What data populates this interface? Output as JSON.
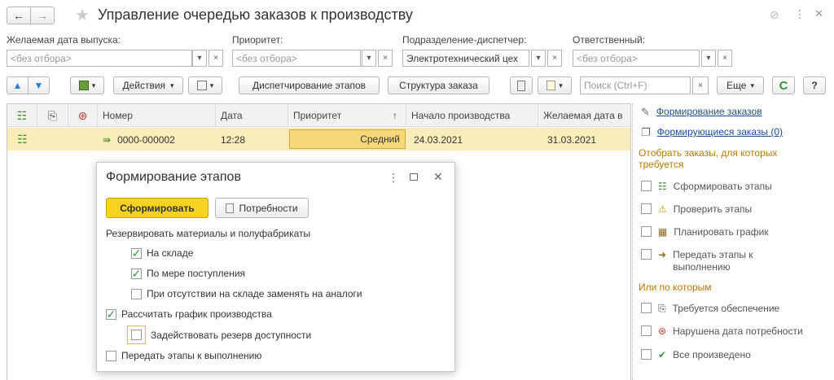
{
  "header": {
    "title": "Управление очередью заказов к производству",
    "back": "←",
    "forward": "→"
  },
  "filters": {
    "date_label": "Желаемая дата выпуска:",
    "date_value": "<без отбора>",
    "priority_label": "Приоритет:",
    "priority_value": "<без отбора>",
    "division_label": "Подразделение-диспетчер:",
    "division_value": "Электротехнический цех",
    "responsible_label": "Ответственный:",
    "responsible_value": "<без отбора>"
  },
  "toolbar": {
    "actions": "Действия",
    "dispatch": "Диспетчирование этапов",
    "structure": "Структура заказа",
    "search_placeholder": "Поиск (Ctrl+F)",
    "more": "Еще",
    "help": "?"
  },
  "table": {
    "columns": [
      "Номер",
      "Дата",
      "Приоритет",
      "Начало производства",
      "Желаемая дата в"
    ],
    "sort_indicator": "↑",
    "rows": [
      {
        "number": "0000-000002",
        "date": "12:28",
        "priority": "Средний",
        "start": "24.03.2021",
        "desired": "31.03.2021"
      }
    ]
  },
  "dialog": {
    "title": "Формирование этапов",
    "primary": "Сформировать",
    "needs": "Потребности",
    "reserve_label": "Резервировать материалы и полуфабрикаты",
    "options": [
      {
        "label": "На складе",
        "checked": true
      },
      {
        "label": "По мере поступления",
        "checked": true
      },
      {
        "label": "При отсутствии на складе заменять на аналоги",
        "checked": false
      },
      {
        "label": "Рассчитать график производства",
        "checked": true
      },
      {
        "label": "Задействовать резерв доступности",
        "checked": false
      },
      {
        "label": "Передать этапы к выполнению",
        "checked": false
      }
    ]
  },
  "right_panel": {
    "link1": "Формирование заказов",
    "link2": "Формирующиеся заказы (0)",
    "select_label": "Отобрать заказы, для которых требуется",
    "items": [
      "Сформировать этапы",
      "Проверить этапы",
      "Планировать график",
      "Передать этапы к выполнению"
    ],
    "or_label": "Или по которым",
    "items2": [
      "Требуется обеспечение",
      "Нарушена дата потребности",
      "Все произведено"
    ]
  }
}
